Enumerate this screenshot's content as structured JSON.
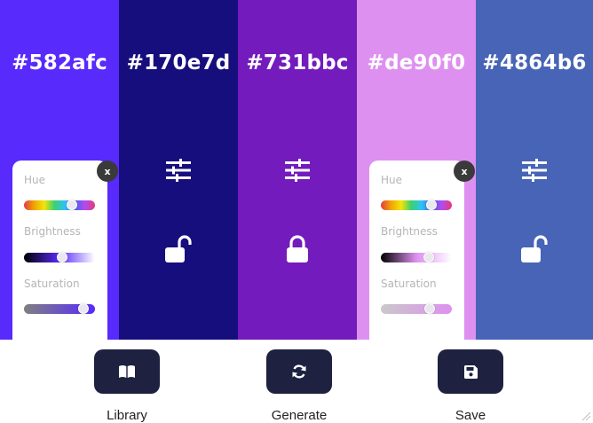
{
  "palette": {
    "colors": [
      {
        "hex": "#582afc",
        "locked": false,
        "panel_open": true
      },
      {
        "hex": "#170e7d",
        "locked": false,
        "panel_open": false
      },
      {
        "hex": "#731bbc",
        "locked": true,
        "panel_open": false
      },
      {
        "hex": "#de90f0",
        "locked": false,
        "panel_open": true
      },
      {
        "hex": "#4864b6",
        "locked": false,
        "panel_open": false
      }
    ]
  },
  "panels": [
    {
      "close_label": "x",
      "hue_label": "Hue",
      "brightness_label": "Brightness",
      "saturation_label": "Saturation",
      "hue_position": 0.7,
      "brightness_position": 0.55,
      "saturation_position": 0.9,
      "brightness_gradient": [
        "#000000",
        "#582afc",
        "#ffffff"
      ],
      "saturation_gradient": [
        "#808080",
        "#582afc"
      ]
    },
    {
      "close_label": "x",
      "hue_label": "Hue",
      "brightness_label": "Brightness",
      "saturation_label": "Saturation",
      "hue_position": 0.75,
      "brightness_position": 0.7,
      "saturation_position": 0.72,
      "brightness_gradient": [
        "#000000",
        "#de90f0",
        "#ffffff"
      ],
      "saturation_gradient": [
        "#c9c9c9",
        "#de90f0"
      ]
    }
  ],
  "actions": {
    "library_label": "Library",
    "generate_label": "Generate",
    "save_label": "Save"
  },
  "colors": {
    "action_button_bg": "#1e2140",
    "icon_white": "#ffffff"
  },
  "icons": {
    "adjust": "sliders-icon",
    "lock_open": "unlock-icon",
    "lock_closed": "lock-icon",
    "library": "book-icon",
    "generate": "refresh-icon",
    "save": "floppy-disk-icon"
  }
}
